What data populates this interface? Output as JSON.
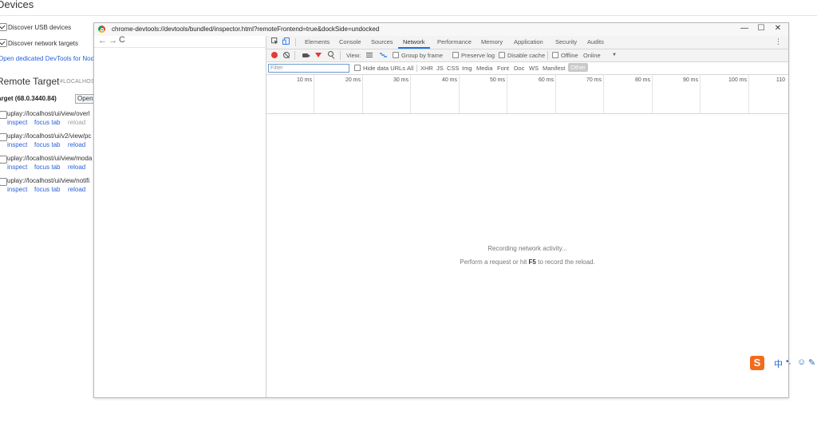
{
  "background_page": {
    "title": "Devices",
    "options": [
      {
        "label": "Discover USB devices",
        "checked": true
      },
      {
        "label": "Discover network targets",
        "checked": true
      }
    ],
    "open_node_link": "Open dedicated DevTools for Nod",
    "remote_target_title": "Remote Target",
    "remote_target_sub": "#LOCALHOST",
    "target_title": "arget (68.0.3440.84)",
    "open_button": "Open",
    "targets": [
      {
        "url": "uplay://localhost/ui/view/overl",
        "actions": [
          "inspect",
          "focus tab",
          "reload"
        ]
      },
      {
        "url": "uplay://localhost/ui/v2/view/pc",
        "actions": [
          "inspect",
          "focus tab",
          "reload"
        ]
      },
      {
        "url": "uplay://localhost/ui/view/moda",
        "actions": [
          "inspect",
          "focus tab",
          "reload"
        ]
      },
      {
        "url": "uplay://localhost/ui/view/notifi",
        "actions": [
          "inspect",
          "focus tab",
          "reload"
        ]
      }
    ]
  },
  "devtools_window": {
    "url": "chrome-devtools://devtools/bundled/inspector.html?remoteFrontend=true&dockSide=undocked",
    "window_controls": {
      "minimize": "—",
      "maximize": "☐",
      "close": "✕"
    },
    "nav": {
      "back": "←",
      "forward": "→",
      "reload": "C"
    },
    "tabs": [
      "Elements",
      "Console",
      "Sources",
      "Network",
      "Performance",
      "Memory",
      "Application",
      "Security",
      "Audits"
    ],
    "active_tab": "Network",
    "kebab": "⋮",
    "toolbar": {
      "view_label": "View:",
      "group_by_frame": "Group by frame",
      "preserve_log": "Preserve log",
      "disable_cache": "Disable cache",
      "offline": "Offline",
      "throttle": "Online",
      "throttle_arrow": "▼"
    },
    "filter": {
      "placeholder": "Filter",
      "hide_data_urls": "Hide data URLs",
      "types": [
        "All",
        "XHR",
        "JS",
        "CSS",
        "Img",
        "Media",
        "Font",
        "Doc",
        "WS",
        "Manifest",
        "Other"
      ],
      "selected_type": "Other"
    },
    "timeline_ticks": [
      "10 ms",
      "20 ms",
      "30 ms",
      "40 ms",
      "50 ms",
      "60 ms",
      "70 ms",
      "80 ms",
      "90 ms",
      "100 ms",
      "110"
    ],
    "empty_state": {
      "line1": "Recording network activity...",
      "line2_pre": "Perform a request or hit ",
      "line2_key": "F5",
      "line2_post": " to record the reload."
    }
  },
  "ime_toolbar": {
    "logo": "S",
    "items": [
      "中",
      "•,",
      "☺",
      "✎"
    ]
  },
  "colors": {
    "record_red": "#e53935",
    "active_tab_blue": "#1a73e8",
    "link_blue": "#2962d9",
    "ime_orange": "#f26b1d"
  }
}
